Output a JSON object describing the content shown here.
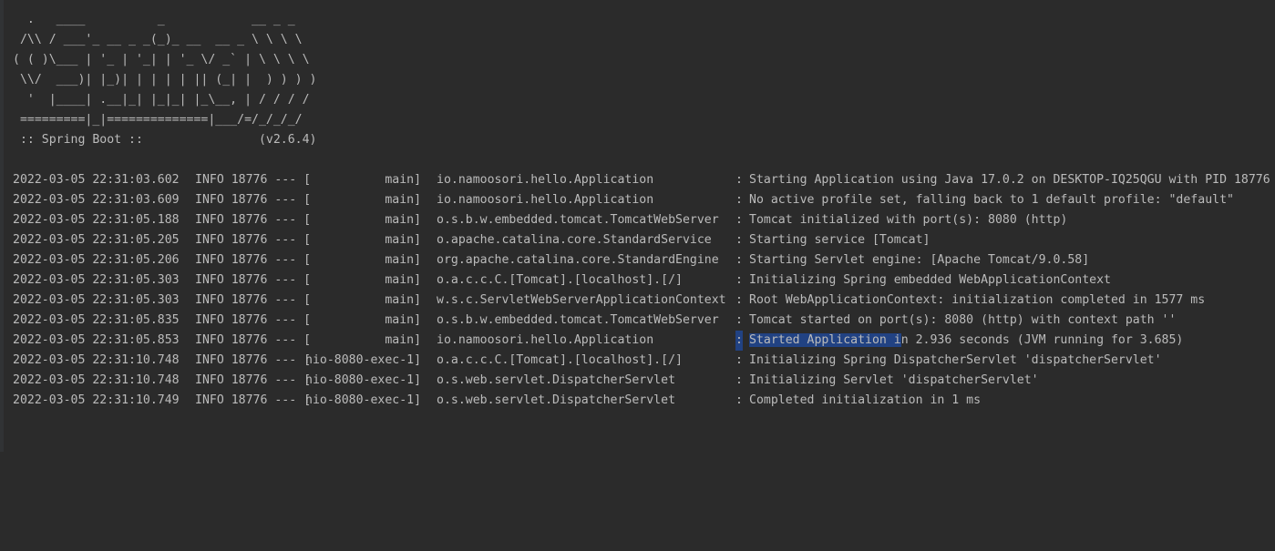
{
  "banner": {
    "art": "  .   ____          _            __ _ _\n /\\\\ / ___'_ __ _ _(_)_ __  __ _ \\ \\ \\ \\\n( ( )\\___ | '_ | '_| | '_ \\/ _` | \\ \\ \\ \\\n \\\\/  ___)| |_)| | | | | || (_| |  ) ) ) )\n  '  |____| .__|_| |_|_| |_\\__, | / / / /\n =========|_|==============|___/=/_/_/_/\n :: Spring Boot ::                (v2.6.4)"
  },
  "log": [
    {
      "timestamp": "2022-03-05 22:31:03.602",
      "level_pid": "INFO 18776 --- [",
      "thread": "           main]",
      "logger": "io.namoosori.hello.Application",
      "sep": ":",
      "message": "Starting Application using Java 17.0.2 on DESKTOP-IQ25QGU with PID 18776"
    },
    {
      "timestamp": "2022-03-05 22:31:03.609",
      "level_pid": "INFO 18776 --- [",
      "thread": "           main]",
      "logger": "io.namoosori.hello.Application",
      "sep": ":",
      "message": "No active profile set, falling back to 1 default profile: \"default\""
    },
    {
      "timestamp": "2022-03-05 22:31:05.188",
      "level_pid": "INFO 18776 --- [",
      "thread": "           main]",
      "logger": "o.s.b.w.embedded.tomcat.TomcatWebServer",
      "sep": ":",
      "message": "Tomcat initialized with port(s): 8080 (http)"
    },
    {
      "timestamp": "2022-03-05 22:31:05.205",
      "level_pid": "INFO 18776 --- [",
      "thread": "           main]",
      "logger": "o.apache.catalina.core.StandardService",
      "sep": ":",
      "message": "Starting service [Tomcat]"
    },
    {
      "timestamp": "2022-03-05 22:31:05.206",
      "level_pid": "INFO 18776 --- [",
      "thread": "           main]",
      "logger": "org.apache.catalina.core.StandardEngine",
      "sep": ":",
      "message": "Starting Servlet engine: [Apache Tomcat/9.0.58]"
    },
    {
      "timestamp": "2022-03-05 22:31:05.303",
      "level_pid": "INFO 18776 --- [",
      "thread": "           main]",
      "logger": "o.a.c.c.C.[Tomcat].[localhost].[/]",
      "sep": ":",
      "message": "Initializing Spring embedded WebApplicationContext"
    },
    {
      "timestamp": "2022-03-05 22:31:05.303",
      "level_pid": "INFO 18776 --- [",
      "thread": "           main]",
      "logger": "w.s.c.ServletWebServerApplicationContext",
      "sep": ":",
      "message": "Root WebApplicationContext: initialization completed in 1577 ms"
    },
    {
      "timestamp": "2022-03-05 22:31:05.835",
      "level_pid": "INFO 18776 --- [",
      "thread": "           main]",
      "logger": "o.s.b.w.embedded.tomcat.TomcatWebServer",
      "sep": ":",
      "message": "Tomcat started on port(s): 8080 (http) with context path ''"
    },
    {
      "timestamp": "2022-03-05 22:31:05.853",
      "level_pid": "INFO 18776 --- [",
      "thread": "           main]",
      "logger": "io.namoosori.hello.Application",
      "sep": ":",
      "message_selected": "Started Application i",
      "message_rest": "n 2.936 seconds (JVM running for 3.685)"
    },
    {
      "timestamp": "2022-03-05 22:31:10.748",
      "level_pid": "INFO 18776 --- [",
      "thread": "nio-8080-exec-1]",
      "logger": "o.a.c.c.C.[Tomcat].[localhost].[/]",
      "sep": ":",
      "message": "Initializing Spring DispatcherServlet 'dispatcherServlet'"
    },
    {
      "timestamp": "2022-03-05 22:31:10.748",
      "level_pid": "INFO 18776 --- [",
      "thread": "nio-8080-exec-1]",
      "logger": "o.s.web.servlet.DispatcherServlet",
      "sep": ":",
      "message": "Initializing Servlet 'dispatcherServlet'"
    },
    {
      "timestamp": "2022-03-05 22:31:10.749",
      "level_pid": "INFO 18776 --- [",
      "thread": "nio-8080-exec-1]",
      "logger": "o.s.web.servlet.DispatcherServlet",
      "sep": ":",
      "message": "Completed initialization in 1 ms"
    }
  ],
  "colors": {
    "background": "#2b2b2b",
    "text": "#bbbbbb",
    "selection": "#214283"
  }
}
